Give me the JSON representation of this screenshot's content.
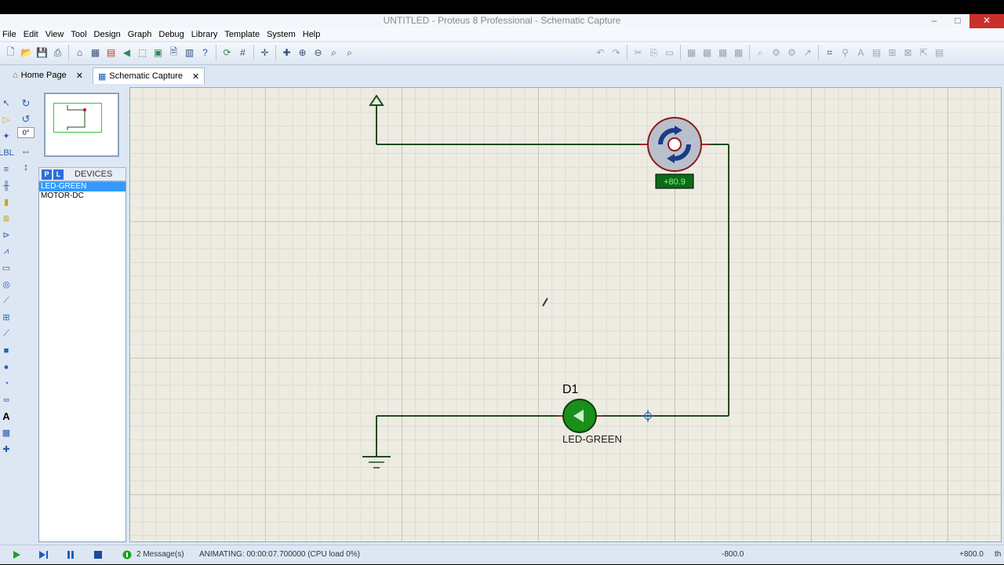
{
  "window": {
    "title": "UNTITLED - Proteus 8 Professional - Schematic Capture",
    "controls": [
      "–",
      "□",
      "✕"
    ]
  },
  "menu": [
    "File",
    "Edit",
    "View",
    "Tool",
    "Design",
    "Graph",
    "Debug",
    "Library",
    "Template",
    "System",
    "Help"
  ],
  "tabs": [
    {
      "label": "Home Page",
      "close": "✕"
    },
    {
      "label": "Schematic Capture",
      "close": "✕"
    }
  ],
  "rotation": {
    "angle": "0°"
  },
  "devices": {
    "p_label": "P",
    "l_label": "L",
    "header": "DEVICES",
    "items": [
      "LED-GREEN",
      "MOTOR-DC"
    ],
    "selected": "LED-GREEN"
  },
  "schematic": {
    "motor_readout": "+80.9",
    "led_ref": "D1",
    "led_value": "LED-GREEN",
    "colors": {
      "wire": "#1f4d1f",
      "led": "#1a8f1a",
      "motor_ring": "#b22222",
      "motor_blade": "#1b3a8a"
    }
  },
  "status": {
    "messages": "2 Message(s)",
    "animating": "ANIMATING: 00:00:07.700000 (CPU load 0%)",
    "coord_x": "-800.0",
    "coord_y": "+800.0",
    "unit": "th"
  }
}
